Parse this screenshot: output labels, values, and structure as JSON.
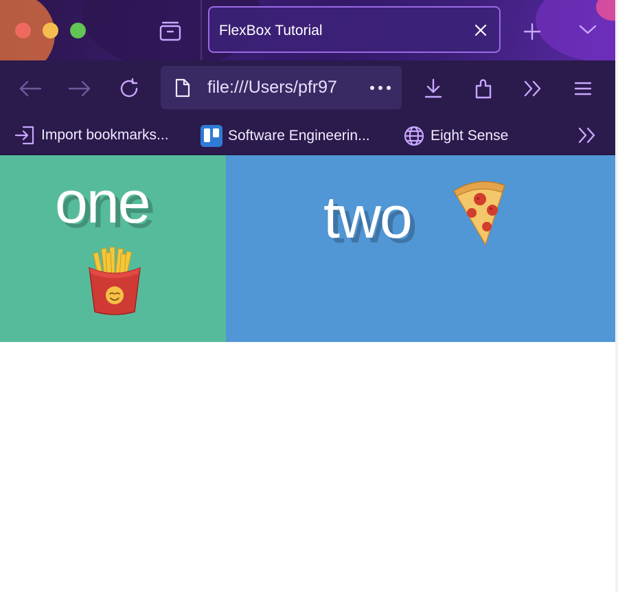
{
  "window": {
    "tab": {
      "title": "FlexBox Tutorial"
    },
    "toolbar": {
      "url": "file:///Users/pfr97"
    },
    "bookmarks": [
      {
        "label": "Import bookmarks..."
      },
      {
        "label": "Software Engineerin..."
      },
      {
        "label": "Eight Sense"
      }
    ]
  },
  "page": {
    "box_one": {
      "text": "one"
    },
    "box_two": {
      "text": "two"
    }
  },
  "colors": {
    "box_one": "#56bb9b",
    "box_two": "#5196d5",
    "accent": "#a57cf0",
    "toolbar": "#2b1a4c"
  },
  "icons": [
    "tab-manager-icon",
    "new-tab-icon",
    "tab-list-chevron-icon",
    "back-arrow-icon",
    "forward-arrow-icon",
    "reload-icon",
    "page-icon",
    "more-dots-icon",
    "download-icon",
    "extensions-icon",
    "overflow-chevrons-icon",
    "menu-icon",
    "import-icon",
    "trello-icon",
    "globe-icon",
    "fries-emoji",
    "pizza-emoji"
  ]
}
